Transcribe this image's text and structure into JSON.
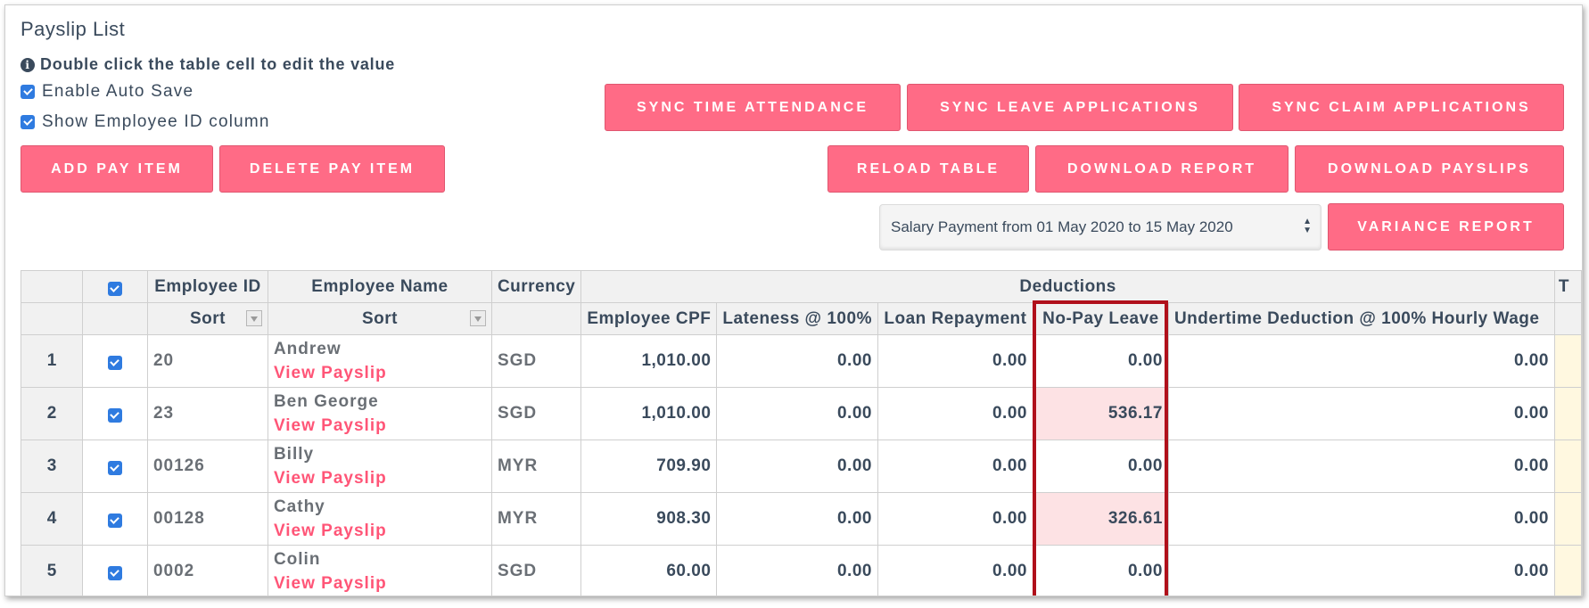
{
  "page": {
    "title": "Payslip List",
    "hint": "Double click the table cell to edit the value",
    "options": [
      {
        "label": "Enable Auto Save",
        "checked": true
      },
      {
        "label": "Show Employee ID column",
        "checked": true
      }
    ]
  },
  "buttons": {
    "sync_time": "SYNC TIME ATTENDANCE",
    "sync_leave": "SYNC LEAVE APPLICATIONS",
    "sync_claim": "SYNC CLAIM APPLICATIONS",
    "add_pay": "ADD PAY ITEM",
    "delete_pay": "DELETE PAY ITEM",
    "reload": "RELOAD TABLE",
    "download_report": "DOWNLOAD REPORT",
    "download_payslips": "DOWNLOAD PAYSLIPS",
    "variance": "VARIANCE REPORT"
  },
  "period_select": {
    "value": "Salary Payment from 01 May 2020 to 15 May 2020"
  },
  "table": {
    "group_headers": {
      "employee_id": "Employee ID",
      "employee_name": "Employee Name",
      "currency": "Currency",
      "deductions": "Deductions",
      "trailing": "T"
    },
    "sort_label": "Sort",
    "columns": {
      "cpf": "Employee CPF",
      "lateness": "Lateness @ 100%",
      "loan": "Loan Repayment",
      "npl": "No-Pay Leave",
      "undertime": "Undertime Deduction @ 100% Hourly Wage"
    },
    "view_payslip_label": "View Payslip",
    "rows": [
      {
        "num": "1",
        "id": "20",
        "name": "Andrew",
        "currency": "SGD",
        "cpf": "1,010.00",
        "lateness": "0.00",
        "loan": "0.00",
        "npl": "0.00",
        "undertime": "0.00",
        "npl_highlight": false
      },
      {
        "num": "2",
        "id": "23",
        "name": "Ben George",
        "currency": "SGD",
        "cpf": "1,010.00",
        "lateness": "0.00",
        "loan": "0.00",
        "npl": "536.17",
        "undertime": "0.00",
        "npl_highlight": true
      },
      {
        "num": "3",
        "id": "00126",
        "name": "Billy",
        "currency": "MYR",
        "cpf": "709.90",
        "lateness": "0.00",
        "loan": "0.00",
        "npl": "0.00",
        "undertime": "0.00",
        "npl_highlight": false
      },
      {
        "num": "4",
        "id": "00128",
        "name": "Cathy",
        "currency": "MYR",
        "cpf": "908.30",
        "lateness": "0.00",
        "loan": "0.00",
        "npl": "326.61",
        "undertime": "0.00",
        "npl_highlight": true
      },
      {
        "num": "5",
        "id": "0002",
        "name": "Colin",
        "currency": "SGD",
        "cpf": "60.00",
        "lateness": "0.00",
        "loan": "0.00",
        "npl": "0.00",
        "undertime": "0.00",
        "npl_highlight": false
      }
    ]
  },
  "colors": {
    "accent": "#ff6b86",
    "link": "#ff5577",
    "highlight_cell": "#fde2e4",
    "callout_border": "#b0101b",
    "checkbox": "#2f7be0"
  }
}
